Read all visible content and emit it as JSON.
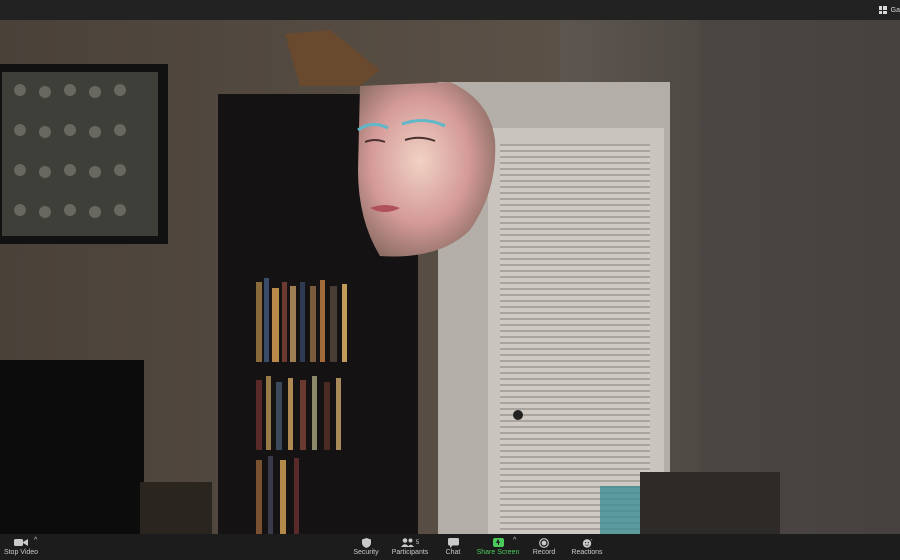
{
  "window": {
    "top_right_label": "Ga"
  },
  "video": {
    "scene": "camera-feed-room-with-floating-face-mask"
  },
  "toolbar": {
    "stop_video": "Stop Video",
    "security": "Security",
    "participants": "Participants",
    "participants_count": "5",
    "chat": "Chat",
    "share_screen": "Share Screen",
    "record": "Record",
    "reactions": "Reactions"
  },
  "colors": {
    "share_accent": "#4bc95a",
    "toolbar_bg": "#1c1c1c",
    "topbar_bg": "#222222"
  },
  "icons": [
    "grid-view-icon",
    "video-camera-icon",
    "caret-up-icon",
    "shield-icon",
    "participants-icon",
    "chat-bubble-icon",
    "share-screen-icon",
    "record-icon",
    "reactions-icon"
  ]
}
